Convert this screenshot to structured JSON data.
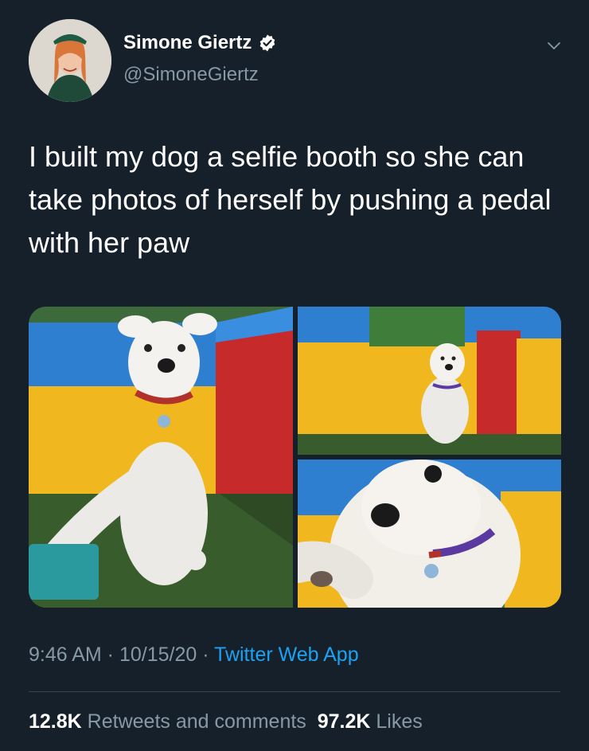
{
  "author": {
    "name": "Simone Giertz",
    "handle": "@SimoneGiertz",
    "verified": true
  },
  "tweet": {
    "text": "I built my dog a selfie booth so she can take photos of herself by pushing a pedal with her paw"
  },
  "media": [
    {
      "description_icon": "photo-dog-booth-wide"
    },
    {
      "description_icon": "photo-dog-booth-small"
    },
    {
      "description_icon": "photo-dog-closeup"
    }
  ],
  "meta": {
    "time": "9:46 AM",
    "sep1": " · ",
    "date": "10/15/20",
    "sep2": " · ",
    "source": "Twitter Web App"
  },
  "stats": {
    "retweets_count": "12.8K",
    "retweets_label": "Retweets and comments",
    "likes_count": "97.2K",
    "likes_label": "Likes"
  },
  "colors": {
    "background": "#15202b",
    "muted": "#8899a6",
    "link": "#1da1f2"
  }
}
